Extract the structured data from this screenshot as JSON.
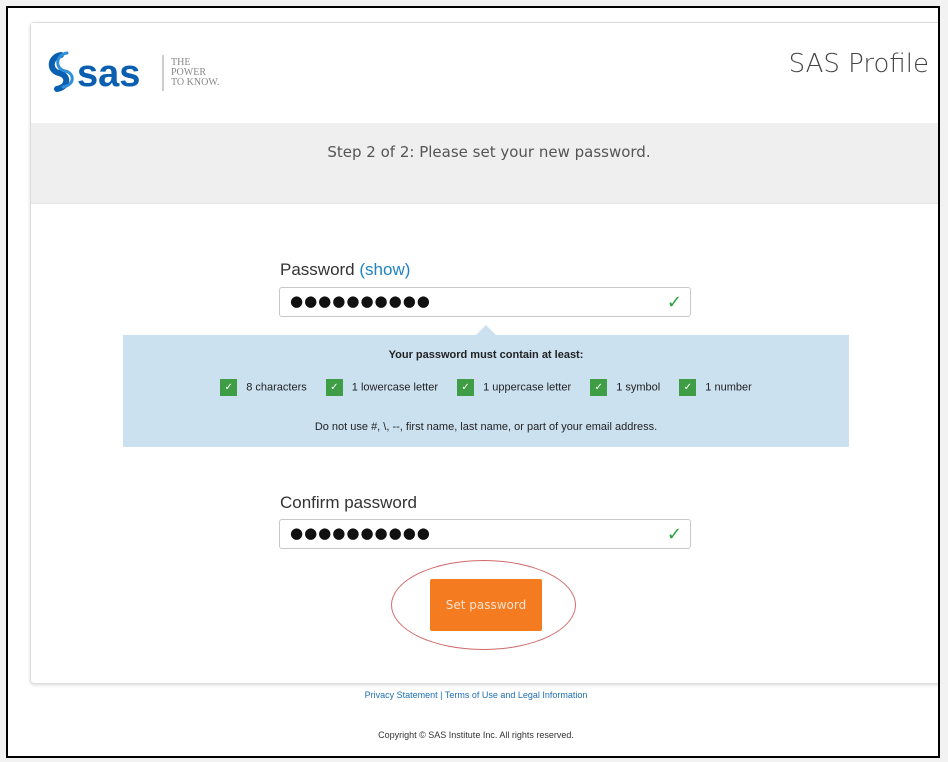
{
  "brand": {
    "logo_text": "sas",
    "tagline_line1": "THE",
    "tagline_line2": "POWER",
    "tagline_line3": "TO KNOW."
  },
  "header": {
    "title": "SAS Profile"
  },
  "step": {
    "text": "Step 2 of 2: Please set your new password."
  },
  "password": {
    "label": "Password",
    "show_link": "(show)",
    "masked_value": "●●●●●●●●●●",
    "valid_icon": "check-icon"
  },
  "requirements": {
    "heading": "Your password must contain at least:",
    "items": [
      {
        "label": "8 characters",
        "met": true
      },
      {
        "label": "1 lowercase letter",
        "met": true
      },
      {
        "label": "1 uppercase letter",
        "met": true
      },
      {
        "label": "1 symbol",
        "met": true
      },
      {
        "label": "1 number",
        "met": true
      }
    ],
    "note": "Do not use #, \\, --, first name, last name, or part of your email address."
  },
  "confirm": {
    "label": "Confirm password",
    "masked_value": "●●●●●●●●●●",
    "valid_icon": "check-icon"
  },
  "submit": {
    "label": "Set password"
  },
  "footer": {
    "privacy": "Privacy Statement",
    "separator": "|",
    "terms": "Terms of Use and Legal Information",
    "copyright": "Copyright © SAS Institute Inc. All rights reserved."
  },
  "colors": {
    "accent_orange": "#f47b20",
    "link_blue": "#1f83c4",
    "check_green": "#3f9e45",
    "req_panel": "#cbe1f0",
    "annotation_red": "#d16a6a"
  }
}
